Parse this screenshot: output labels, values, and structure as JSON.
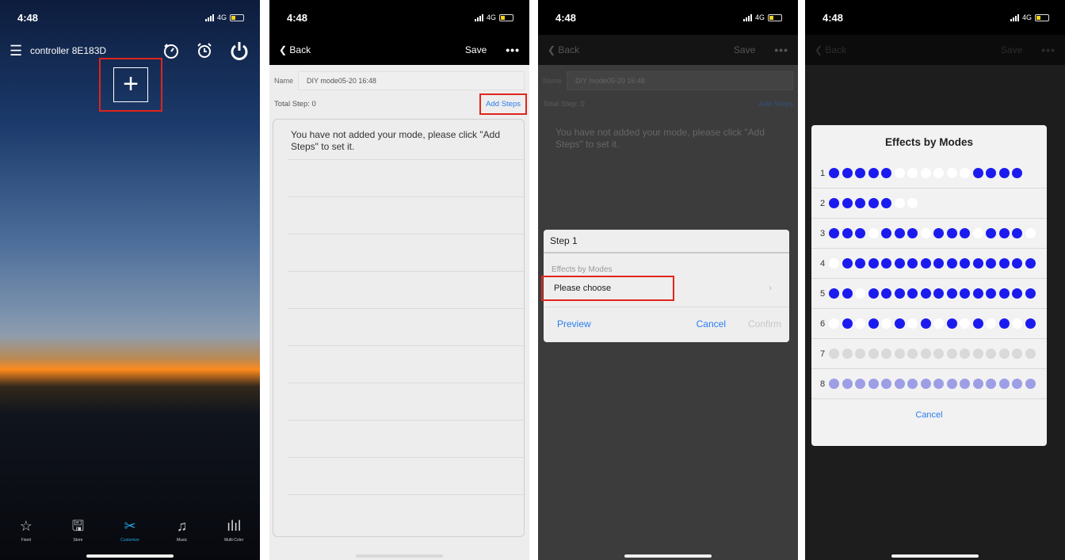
{
  "status": {
    "time": "4:48",
    "network": "4G"
  },
  "screen1": {
    "title": "controller 8E183D",
    "tabs": [
      {
        "label": "Fixed",
        "icon": "star-outline-icon"
      },
      {
        "label": "Store",
        "icon": "floppy-disk-icon"
      },
      {
        "label": "Customize",
        "icon": "customize-icon",
        "active": true
      },
      {
        "label": "Music",
        "icon": "music-note-icon"
      },
      {
        "label": "Multi-Color",
        "icon": "equalizer-bars-icon"
      }
    ]
  },
  "screen2": {
    "back": "Back",
    "save": "Save",
    "more": "•••",
    "name_label": "Name",
    "name_value": "DIY mode05-20 16:48",
    "total_step": "Total Step: 0",
    "add_steps": "Add Steps",
    "empty_message": "You have not added your mode, please click \"Add Steps\" to set it."
  },
  "screen3": {
    "dialog": {
      "title": "Step 1",
      "subtitle": "Effects by Modes",
      "choose": "Please choose",
      "preview": "Preview",
      "cancel": "Cancel",
      "confirm": "Confirm"
    }
  },
  "screen4": {
    "title": "Effects by Modes",
    "cancel": "Cancel",
    "colors": {
      "b": "#1b1bf0",
      "w": "#ffffff",
      "g": "#d9d9d9",
      "l": "#9e9ee6"
    },
    "modes": [
      {
        "num": "1",
        "dots": "bbbbbwwwwwwbbbb"
      },
      {
        "num": "2",
        "dots": "bbbbbww"
      },
      {
        "num": "3",
        "dots": "bbbwbbbwbbbwbbbw"
      },
      {
        "num": "4",
        "dots": "wbbbbbbbbbbbbbbb"
      },
      {
        "num": "5",
        "dots": "bbwbbbbbbbbbbbbb"
      },
      {
        "num": "6",
        "dots": "wbwbwbwbwbwbwbwb"
      },
      {
        "num": "7",
        "dots": "gggggggggggggggg"
      },
      {
        "num": "8",
        "dots": "llllllllllllllll"
      }
    ]
  }
}
